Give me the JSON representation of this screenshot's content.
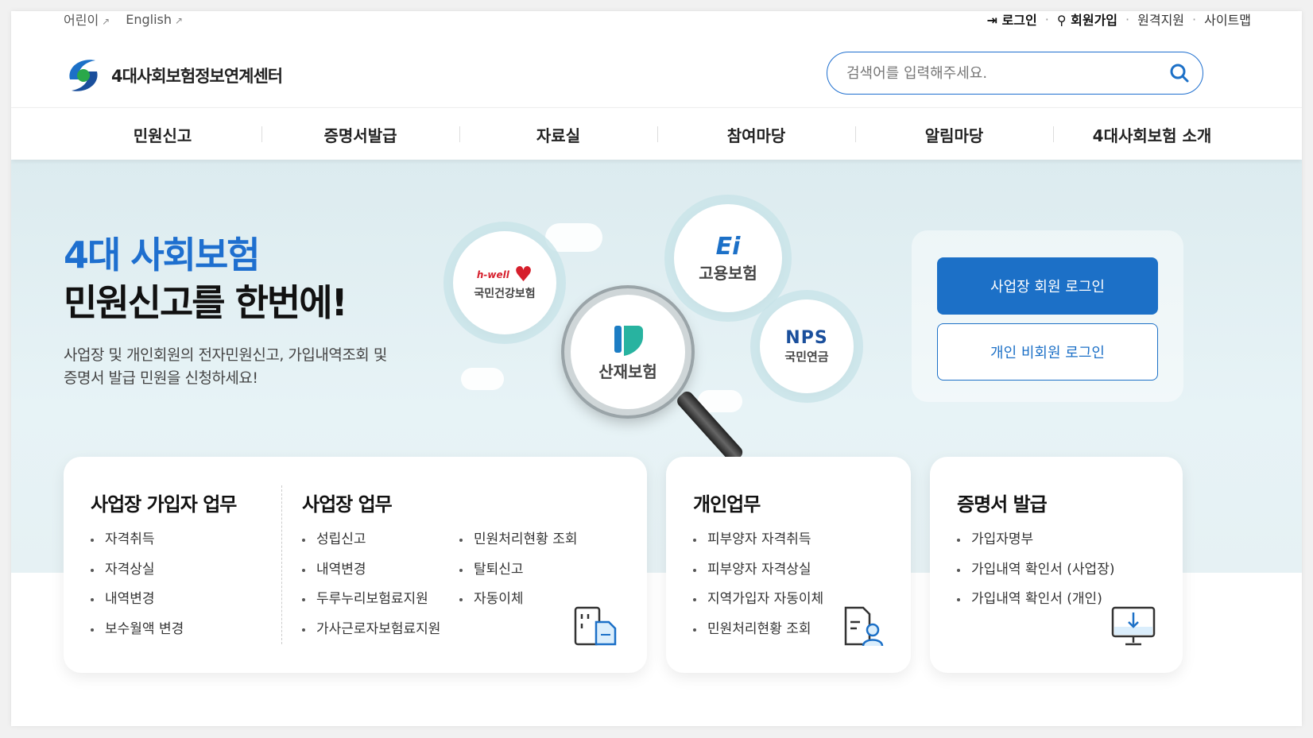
{
  "utility": {
    "kids": "어린이",
    "english": "English",
    "login": "로그인",
    "join": "회원가입",
    "remote": "원격지원",
    "sitemap": "사이트맵",
    "sep": "·"
  },
  "header": {
    "logo_text": "4대사회보험정보연계센터",
    "search_placeholder": "검색어를 입력해주세요."
  },
  "gnb": [
    "민원신고",
    "증명서발급",
    "자료실",
    "참여마당",
    "알림마당",
    "4대사회보험 소개"
  ],
  "hero": {
    "title_line1": "4대 사회보험",
    "title_line2": "민원신고를 한번에!",
    "desc_line1": "사업장 및 개인회원의 전자민원신고, 가입내역조회 및",
    "desc_line2": "증명서 발급 민원을 신청하세요!"
  },
  "insurers": {
    "health_brand": "h-well",
    "health": "국민건강보험",
    "employment": "고용보험",
    "accident": "산재보험",
    "pension_brand": "NPS",
    "pension": "국민연금"
  },
  "login": {
    "business": "사업장 회원 로그인",
    "individual": "개인 비회원 로그인"
  },
  "cards": {
    "biz_member": {
      "title": "사업장 가입자 업무",
      "items": [
        "자격취득",
        "자격상실",
        "내역변경",
        "보수월액 변경"
      ]
    },
    "biz": {
      "title": "사업장 업무",
      "col1": [
        "성립신고",
        "내역변경",
        "두루누리보험료지원",
        "가사근로자보험료지원"
      ],
      "col2": [
        "민원처리현황 조회",
        "탈퇴신고",
        "자동이체"
      ]
    },
    "personal": {
      "title": "개인업무",
      "items": [
        "피부양자 자격취득",
        "피부양자 자격상실",
        "지역가입자 자동이체",
        "민원처리현황 조회"
      ]
    },
    "cert": {
      "title": "증명서 발급",
      "items": [
        "가입자명부",
        "가입내역 확인서 (사업장)",
        "가입내역 확인서 (개인)"
      ]
    }
  },
  "colors": {
    "primary": "#1c70c7",
    "hero_bg": "#dcebef",
    "accent_green": "#2aa84a"
  }
}
